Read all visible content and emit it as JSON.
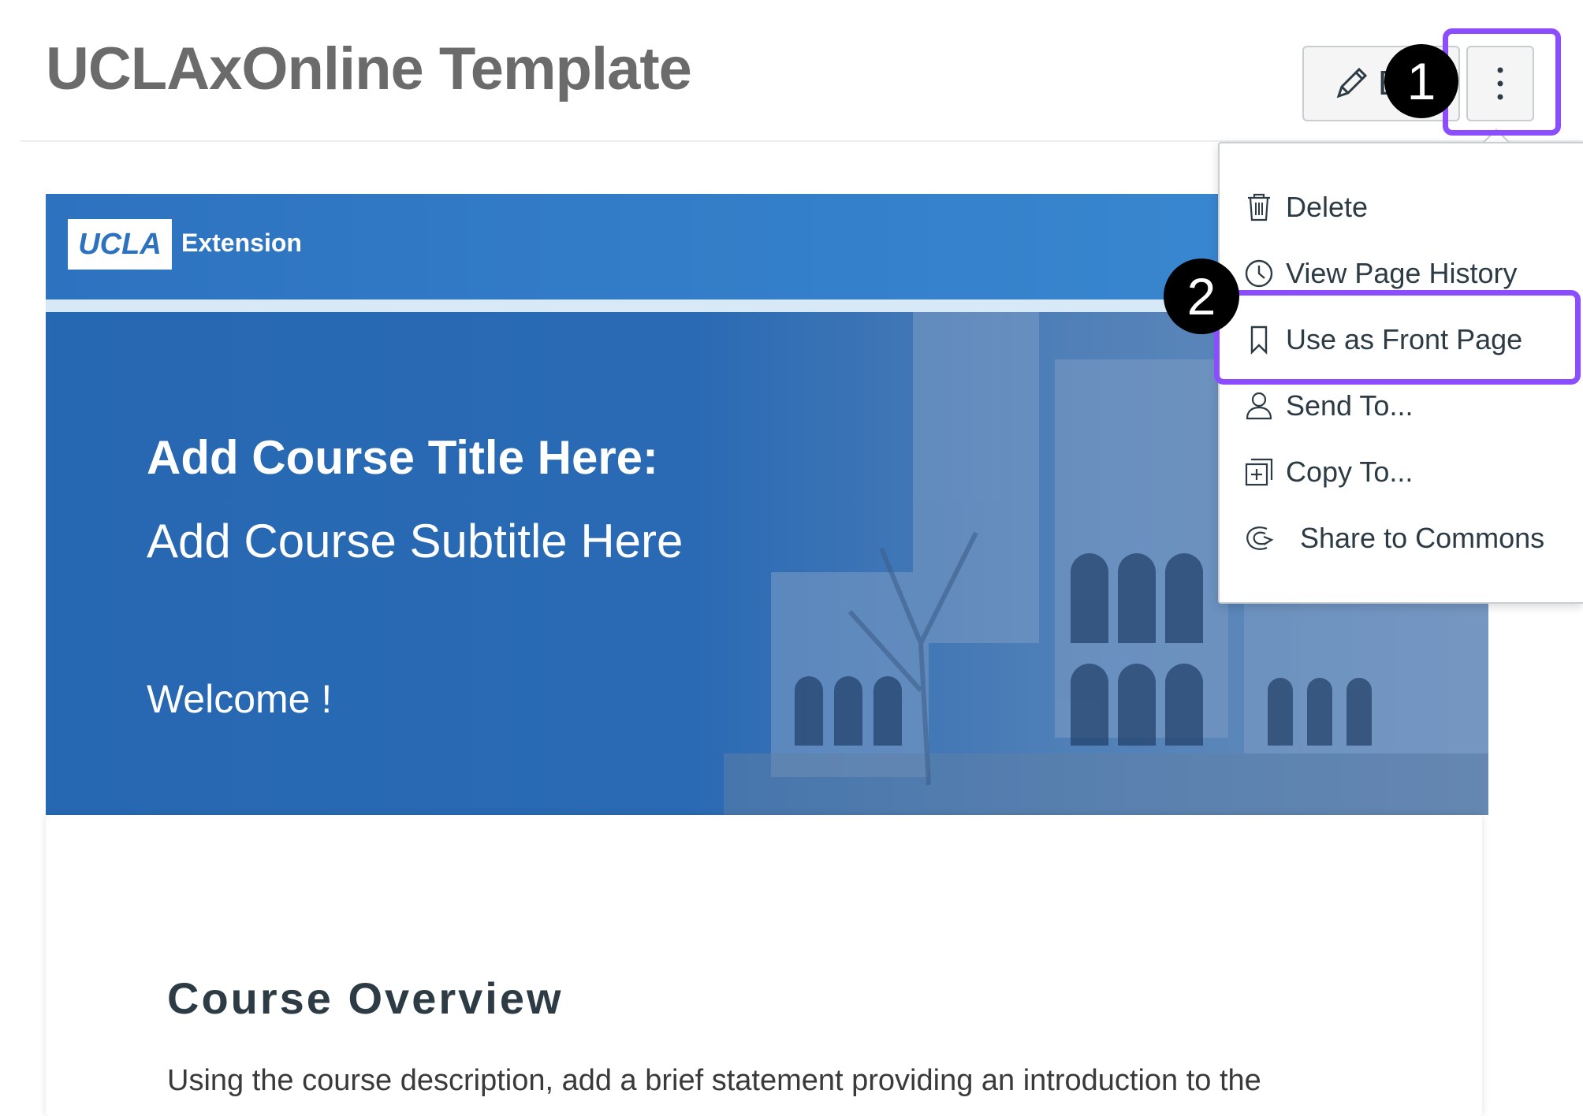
{
  "header": {
    "title": "UCLAxOnline Template",
    "edit_label": "E"
  },
  "callouts": {
    "step_one": "1",
    "step_two": "2",
    "highlight_color": "#8a4dff"
  },
  "banner": {
    "logo_text": "UCLA",
    "logo_extension": "Extension",
    "course_title": "Add Course Title Here:",
    "course_subtitle": "Add Course Subtitle Here",
    "welcome": "Welcome !",
    "primary_color": "#2b6cb5"
  },
  "content": {
    "heading": "Course Overview",
    "body": "Using the course description, add a brief statement providing an introduction to the"
  },
  "menu": {
    "items": [
      {
        "label": "Delete",
        "icon": "trash-icon"
      },
      {
        "label": "View Page History",
        "icon": "clock-icon"
      },
      {
        "label": "Use as Front Page",
        "icon": "bookmark-icon"
      },
      {
        "label": "Send To...",
        "icon": "user-icon"
      },
      {
        "label": "Copy To...",
        "icon": "copy-icon"
      },
      {
        "label": "Share to Commons",
        "icon": "commons-icon"
      }
    ]
  }
}
